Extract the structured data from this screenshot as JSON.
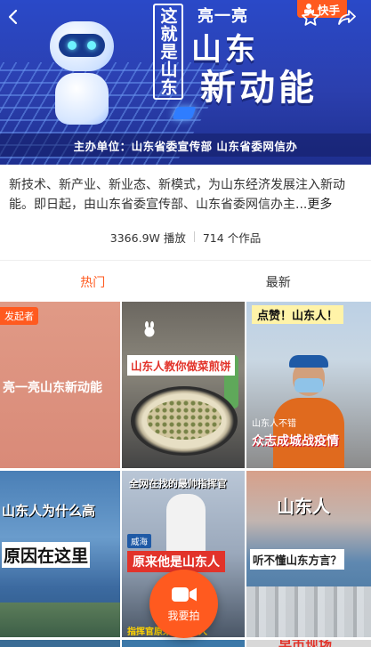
{
  "header": {
    "app_logo": "快手",
    "icons": [
      "back-icon",
      "star-icon",
      "share-icon"
    ]
  },
  "banner": {
    "vertical_title": "这就是山东",
    "liang": "亮一亮",
    "line1": "山东",
    "line2": "新动能",
    "sponsor": "主办单位：山东省委宣传部   山东省委网信办"
  },
  "description": {
    "text": "新技术、新产业、新业态、新模式，为山东经济发展注入新动能。即日起，由山东省委宣传部、山东省委网信办主...",
    "more": "更多"
  },
  "stats": {
    "plays": "3366.9W 播放",
    "works": "714 个作品"
  },
  "tabs": [
    {
      "label": "热门",
      "active": true
    },
    {
      "label": "最新",
      "active": false
    }
  ],
  "videos": [
    {
      "tag": "发起者",
      "caption": "亮一亮山东新动能"
    },
    {
      "caption": "山东人教你做菜煎饼"
    },
    {
      "badge": "点赞！山东人！",
      "small": "山东人不错",
      "caption": "众志成城战疫情"
    },
    {
      "caption1": "山东人为什么高",
      "caption2": "原因在这里"
    },
    {
      "top_caption": "全网在找的最帅指挥官",
      "location": "威海",
      "caption": "原来他是山东人",
      "bottom_caption": "指挥官原来是山东人"
    },
    {
      "caption1": "山东人",
      "caption2": "听不懂山东方言？"
    }
  ],
  "peek": {
    "tile3_text": "早市现场"
  },
  "fab": {
    "label": "我要拍"
  },
  "colors": {
    "accent": "#ff5a1f",
    "banner_blue": "#2b3fae"
  }
}
